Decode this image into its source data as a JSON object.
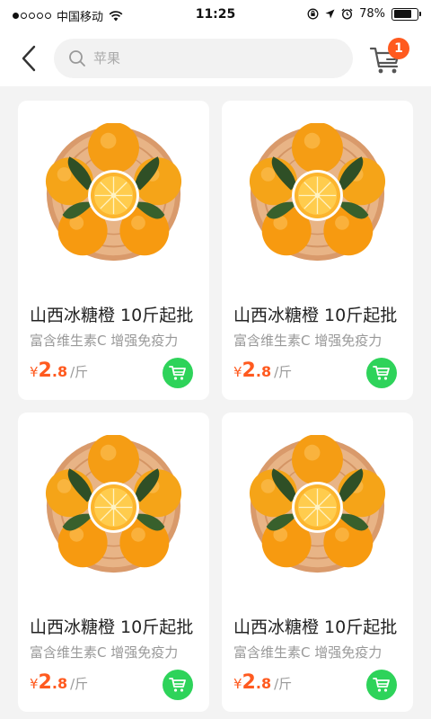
{
  "status_bar": {
    "carrier": "中国移动",
    "time": "11:25",
    "battery": "78%",
    "battery_level": 0.78,
    "signal_bars": 1,
    "signal_total": 5
  },
  "header": {
    "search_placeholder": "苹果",
    "cart_count": "1"
  },
  "colors": {
    "accent": "#ff5a1f",
    "add_cart": "#2ed35a"
  },
  "products": [
    {
      "title": "山西冰糖橙 10斤起批",
      "subtitle": "富含维生素C  增强免疫力",
      "price_symbol": "¥",
      "price_int": "2",
      "price_dec": ".8",
      "unit": "/斤"
    },
    {
      "title": "山西冰糖橙 10斤起批",
      "subtitle": "富含维生素C  增强免疫力",
      "price_symbol": "¥",
      "price_int": "2",
      "price_dec": ".8",
      "unit": "/斤"
    },
    {
      "title": "山西冰糖橙 10斤起批",
      "subtitle": "富含维生素C  增强免疫力",
      "price_symbol": "¥",
      "price_int": "2",
      "price_dec": ".8",
      "unit": "/斤"
    },
    {
      "title": "山西冰糖橙 10斤起批",
      "subtitle": "富含维生素C  增强免疫力",
      "price_symbol": "¥",
      "price_int": "2",
      "price_dec": ".8",
      "unit": "/斤"
    }
  ]
}
